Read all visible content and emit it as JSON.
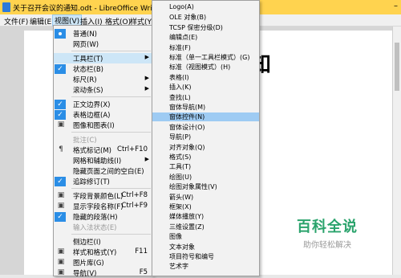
{
  "window": {
    "title": "关于召开会议的通知.odt - LibreOffice Writer"
  },
  "menubar": [
    {
      "label": "文件(F)"
    },
    {
      "label": "编辑(E)"
    },
    {
      "label": "视图(V)"
    },
    {
      "label": "插入(I)"
    },
    {
      "label": "格式(O)"
    },
    {
      "label": "样式(Y)"
    }
  ],
  "document": {
    "heading_fragment": "知"
  },
  "view_menu": [
    {
      "label": "普通(N)",
      "mark": "radio"
    },
    {
      "label": "网页(W)",
      "mark": ""
    },
    {
      "label": "工具栏(T)",
      "mark": "",
      "submenu": true,
      "highlight": true
    },
    {
      "label": "状态栏(B)",
      "mark": "check"
    },
    {
      "label": "标尺(R)",
      "mark": "",
      "submenu": true
    },
    {
      "label": "滚动条(S)",
      "mark": "",
      "submenu": true
    },
    {
      "label": "正文边界(X)",
      "mark": "check"
    },
    {
      "label": "表格边框(A)",
      "mark": "check"
    },
    {
      "label": "图像和图表(I)",
      "mark": "icon"
    },
    {
      "label": "批注(C)",
      "mark": "",
      "disabled": true
    },
    {
      "label": "格式标记(M)",
      "shortcut": "Ctrl+F10",
      "mark": "pilcrow"
    },
    {
      "label": "网格和辅助线(I)",
      "mark": "",
      "submenu": true
    },
    {
      "label": "隐藏页面之间的空白(E)",
      "mark": ""
    },
    {
      "label": "追踪修订(T)",
      "mark": "check"
    },
    {
      "label": "字段背景颜色(L)",
      "shortcut": "Ctrl+F8",
      "mark": "icon"
    },
    {
      "label": "显示字段名称(F)",
      "shortcut": "Ctrl+F9",
      "mark": "icon"
    },
    {
      "label": "隐藏的段落(H)",
      "mark": "check"
    },
    {
      "label": "输入法状态(E)",
      "mark": "",
      "disabled": true
    },
    {
      "label": "侧边栏(I)",
      "mark": ""
    },
    {
      "label": "样式和格式(Y)",
      "shortcut": "F11",
      "mark": "icon"
    },
    {
      "label": "图片库(G)",
      "mark": "icon"
    },
    {
      "label": "导航(V)",
      "shortcut": "F5",
      "mark": "icon"
    }
  ],
  "toolbar_submenu": [
    "Logo(A)",
    "OLE 对象(B)",
    "TCSP 保密分级(D)",
    "编辑点(E)",
    "标准(F)",
    "标准（单一工具栏模式）(G)",
    "标准（视图模式）(H)",
    "表格(I)",
    "插入(K)",
    "查找(L)",
    "窗体导航(M)",
    "窗体控件(N)",
    "窗体设计(O)",
    "导航(P)",
    "对齐对象(Q)",
    "格式(S)",
    "工具(T)",
    "绘图(U)",
    "绘图对象属性(V)",
    "箭头(W)",
    "框架(X)",
    "媒体播放(Y)",
    "三维设置(Z)",
    "图像",
    "文本对象",
    "项目符号和编号",
    "艺术字"
  ],
  "toolbar_submenu_highlight": "窗体控件(N)",
  "watermark": {
    "title": "百科全说",
    "subtitle": "助你轻松解决"
  }
}
